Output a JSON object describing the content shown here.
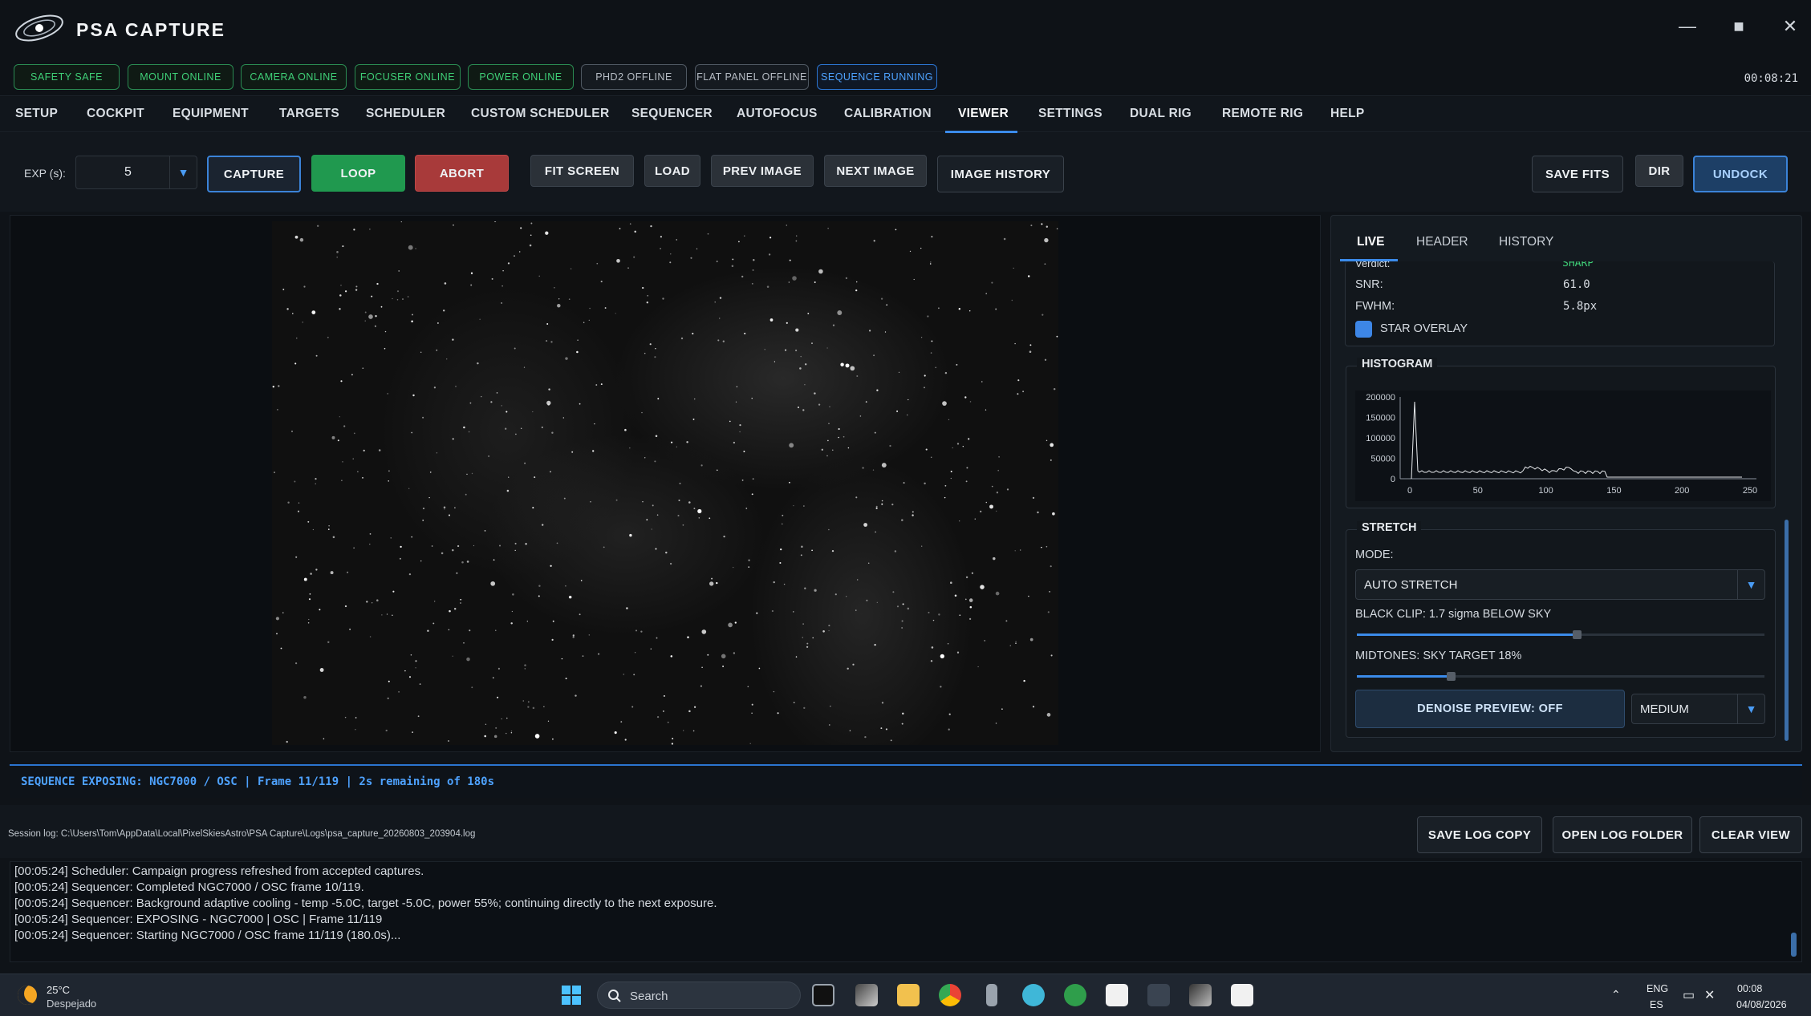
{
  "app": {
    "title": "PSA CAPTURE"
  },
  "window_controls": {
    "minimize": "—",
    "maximize": "■",
    "close": "✕"
  },
  "status": {
    "pills": [
      {
        "label": "SAFETY SAFE",
        "state": "online"
      },
      {
        "label": "MOUNT ONLINE",
        "state": "online"
      },
      {
        "label": "CAMERA ONLINE",
        "state": "online"
      },
      {
        "label": "FOCUSER ONLINE",
        "state": "online"
      },
      {
        "label": "POWER ONLINE",
        "state": "online"
      },
      {
        "label": "PHD2 OFFLINE",
        "state": "offline"
      },
      {
        "label": "FLAT PANEL OFFLINE",
        "state": "offline"
      },
      {
        "label": "SEQUENCE RUNNING",
        "state": "running"
      }
    ],
    "clock": "00:08:21"
  },
  "nav": {
    "tabs": [
      "SETUP",
      "COCKPIT",
      "EQUIPMENT",
      "TARGETS",
      "SCHEDULER",
      "CUSTOM SCHEDULER",
      "SEQUENCER",
      "AUTOFOCUS",
      "CALIBRATION",
      "VIEWER",
      "SETTINGS",
      "DUAL RIG",
      "REMOTE RIG",
      "HELP"
    ],
    "active": "VIEWER"
  },
  "toolbar": {
    "exp_label": "EXP (s):",
    "exp_value": "5",
    "capture": "CAPTURE",
    "loop": "LOOP",
    "abort": "ABORT",
    "fit_screen": "FIT SCREEN",
    "load": "LOAD",
    "prev_image": "PREV IMAGE",
    "next_image": "NEXT IMAGE",
    "image_history": "IMAGE HISTORY",
    "save_fits": "SAVE FITS",
    "dir": "DIR",
    "undock": "UNDOCK"
  },
  "panel": {
    "tabs": [
      "LIVE",
      "HEADER",
      "HISTORY"
    ],
    "active_tab": "LIVE",
    "verdict_label": "Verdict:",
    "verdict_value": "SHARP",
    "snr_label": "SNR:",
    "snr_value": "61.0",
    "fwhm_label": "FWHM:",
    "fwhm_value": "5.8px",
    "star_overlay": "STAR OVERLAY",
    "star_overlay_checked": true,
    "histogram_title": "HISTOGRAM",
    "hist_y_ticks": [
      "200000",
      "150000",
      "100000",
      "50000",
      "0"
    ],
    "hist_x_ticks": [
      "0",
      "50",
      "100",
      "150",
      "200",
      "250"
    ],
    "stretch_title": "STRETCH",
    "mode_label": "MODE:",
    "mode_value": "AUTO STRETCH",
    "black_clip_label": "BLACK CLIP: 1.7 sigma BELOW SKY",
    "black_clip_level": 0.54,
    "midtones_label": "MIDTONES: SKY TARGET 18%",
    "midtones_level": 0.23,
    "denoise_button": "DENOISE PREVIEW: OFF",
    "denoise_level": "MEDIUM"
  },
  "sequence_status": "SEQUENCE EXPOSING: NGC7000 / OSC | Frame 11/119 | 2s remaining of 180s",
  "log": {
    "path": "Session log: C:\\Users\\Tom\\AppData\\Local\\PixelSkiesAstro\\PSA Capture\\Logs\\psa_capture_20260803_203904.log",
    "save_copy": "SAVE LOG COPY",
    "open_folder": "OPEN LOG FOLDER",
    "clear_view": "CLEAR VIEW",
    "lines": [
      "[00:05:24] Scheduler: Campaign progress refreshed from accepted captures.",
      "[00:05:24] Sequencer: Completed NGC7000 / OSC frame 10/119.",
      "[00:05:24] Sequencer: Background adaptive cooling - temp -5.0C, target -5.0C, power 55%; continuing directly to the next exposure.",
      "[00:05:24] Sequencer: EXPOSING - NGC7000 | OSC | Frame 11/119",
      "[00:05:24] Sequencer: Starting NGC7000 / OSC frame 11/119 (180.0s)..."
    ]
  },
  "taskbar": {
    "temp": "25°C",
    "weather": "Despejado",
    "search": "Search",
    "lang": "ENG",
    "region": "ES",
    "time": "00:08",
    "date": "04/08/2026"
  }
}
